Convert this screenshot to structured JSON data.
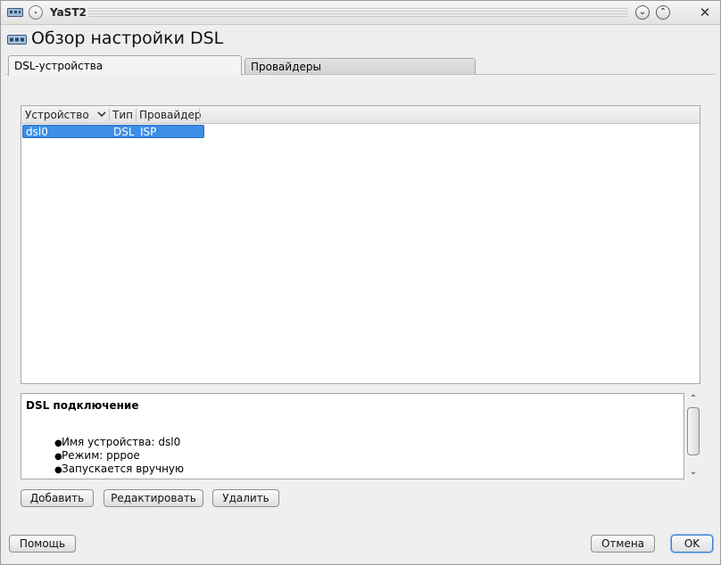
{
  "window": {
    "title": "YaST2"
  },
  "header": {
    "title": "Обзор настройки DSL"
  },
  "tabs": [
    {
      "label": "DSL-устройства",
      "active": true
    },
    {
      "label": "Провайдеры",
      "active": false
    }
  ],
  "table": {
    "columns": [
      "Устройство",
      "Тип",
      "Провайдер"
    ],
    "rows": [
      {
        "device": "dsl0",
        "type": "DSL",
        "provider": "ISP",
        "selected": true
      }
    ]
  },
  "details": {
    "title": "DSL подключение",
    "items": [
      "Имя устройства: dsl0",
      "Режим: pppoe",
      "Запускается вручную"
    ]
  },
  "buttons": {
    "add": "Добавить",
    "edit": "Редактировать",
    "delete": "Удалить",
    "help": "Помощь",
    "cancel": "Отмена",
    "ok": "OK"
  },
  "colors": {
    "selection": "#3d8ee6",
    "window_bg": "#eeeeee",
    "default_button_focus": "#3b7fcf"
  }
}
